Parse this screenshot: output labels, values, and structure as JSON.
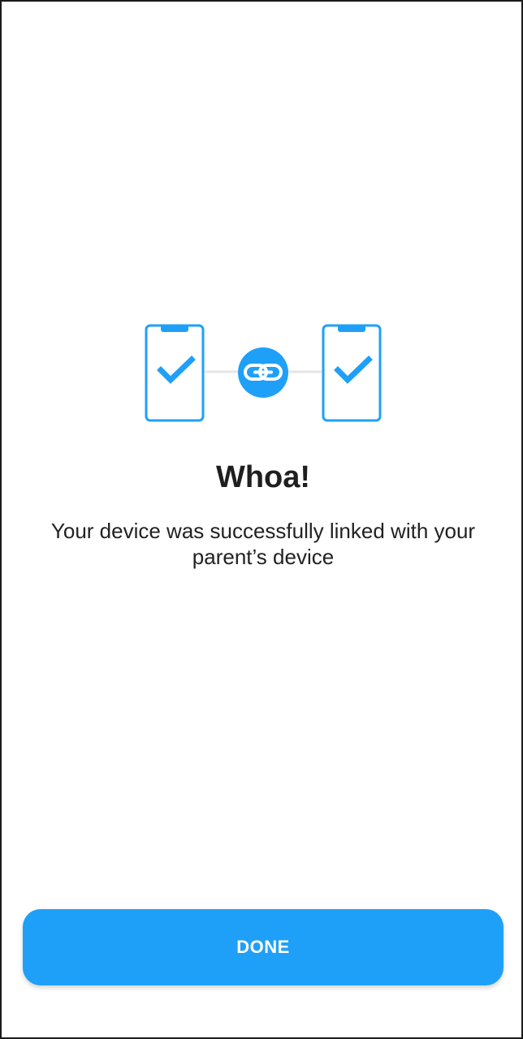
{
  "colors": {
    "accent": "#1fa0f8",
    "text_primary": "#1f1f1f",
    "background": "#ffffff",
    "connector_line": "#e6e6e6"
  },
  "illustration": {
    "left_device_icon": "phone-check-icon",
    "link_icon": "link-icon",
    "right_device_icon": "phone-check-icon"
  },
  "content": {
    "title": "Whoa!",
    "message": "Your device was successfully linked with your parent’s device"
  },
  "actions": {
    "done_label": "DONE"
  }
}
